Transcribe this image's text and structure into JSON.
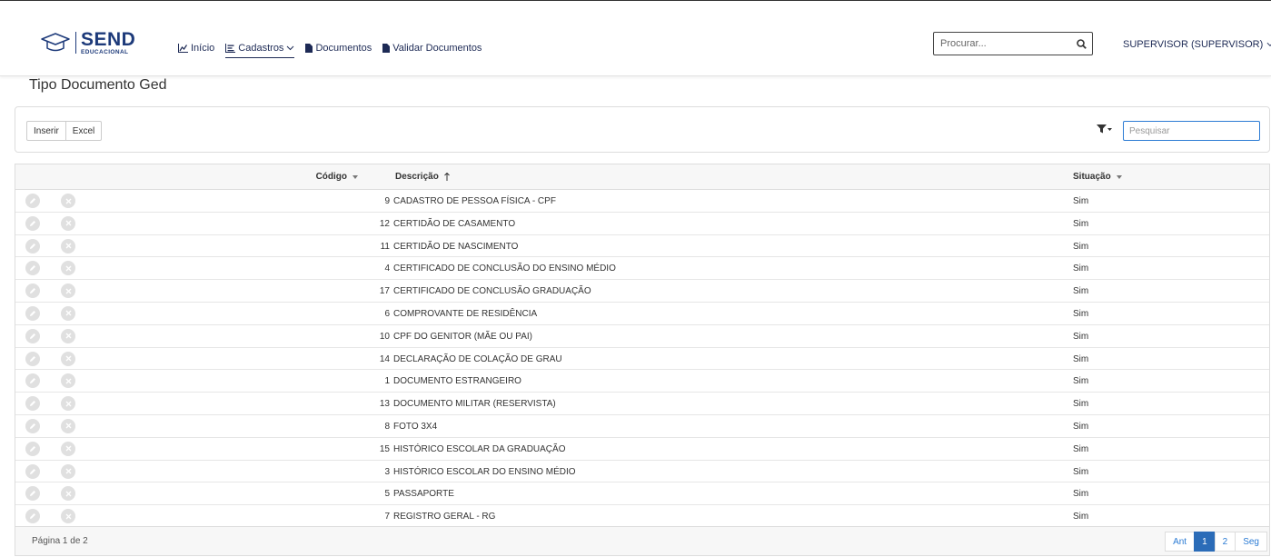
{
  "brand": {
    "name": "SEND",
    "subtitle": "EDUCACIONAL"
  },
  "nav": {
    "items": [
      {
        "label": "Início",
        "icon": "chart-icon"
      },
      {
        "label": "Cadastros",
        "icon": "list-icon"
      },
      {
        "label": "Documentos",
        "icon": "document-icon"
      },
      {
        "label": "Validar Documentos",
        "icon": "document-icon"
      }
    ],
    "search_placeholder": "Procurar...",
    "user": "SUPERVISOR (SUPERVISOR)"
  },
  "page": {
    "title": "Tipo Documento Ged"
  },
  "toolbar": {
    "insert_label": "Inserir",
    "excel_label": "Excel",
    "search_placeholder": "Pesquisar"
  },
  "grid": {
    "columns": {
      "codigo": "Código",
      "descricao": "Descrição",
      "situacao": "Situação"
    },
    "rows": [
      {
        "codigo": "9",
        "descricao": "CADASTRO DE PESSOA FÍSICA - CPF",
        "situacao": "Sim"
      },
      {
        "codigo": "12",
        "descricao": "CERTIDÃO DE CASAMENTO",
        "situacao": "Sim"
      },
      {
        "codigo": "11",
        "descricao": "CERTIDÃO DE NASCIMENTO",
        "situacao": "Sim"
      },
      {
        "codigo": "4",
        "descricao": "CERTIFICADO DE CONCLUSÃO DO ENSINO MÉDIO",
        "situacao": "Sim"
      },
      {
        "codigo": "17",
        "descricao": "CERTIFICADO DE CONCLUSÃO GRADUAÇÃO",
        "situacao": "Sim"
      },
      {
        "codigo": "6",
        "descricao": "COMPROVANTE DE RESIDÊNCIA",
        "situacao": "Sim"
      },
      {
        "codigo": "10",
        "descricao": "CPF DO GENITOR (MÃE OU PAI)",
        "situacao": "Sim"
      },
      {
        "codigo": "14",
        "descricao": "DECLARAÇÃO DE COLAÇÃO DE GRAU",
        "situacao": "Sim"
      },
      {
        "codigo": "1",
        "descricao": "DOCUMENTO ESTRANGEIRO",
        "situacao": "Sim"
      },
      {
        "codigo": "13",
        "descricao": "DOCUMENTO MILITAR (RESERVISTA)",
        "situacao": "Sim"
      },
      {
        "codigo": "8",
        "descricao": "FOTO 3X4",
        "situacao": "Sim"
      },
      {
        "codigo": "15",
        "descricao": "HISTÓRICO ESCOLAR DA GRADUAÇÃO",
        "situacao": "Sim"
      },
      {
        "codigo": "3",
        "descricao": "HISTÓRICO ESCOLAR DO ENSINO MÉDIO",
        "situacao": "Sim"
      },
      {
        "codigo": "5",
        "descricao": "PASSAPORTE",
        "situacao": "Sim"
      },
      {
        "codigo": "7",
        "descricao": "REGISTRO GERAL - RG",
        "situacao": "Sim"
      }
    ]
  },
  "pagination": {
    "info": "Página 1 de 2",
    "prev": "Ant",
    "pages": [
      "1",
      "2"
    ],
    "next": "Seg",
    "current": "1"
  },
  "colors": {
    "brand": "#1d3a7a",
    "accent": "#2b6cb8"
  }
}
